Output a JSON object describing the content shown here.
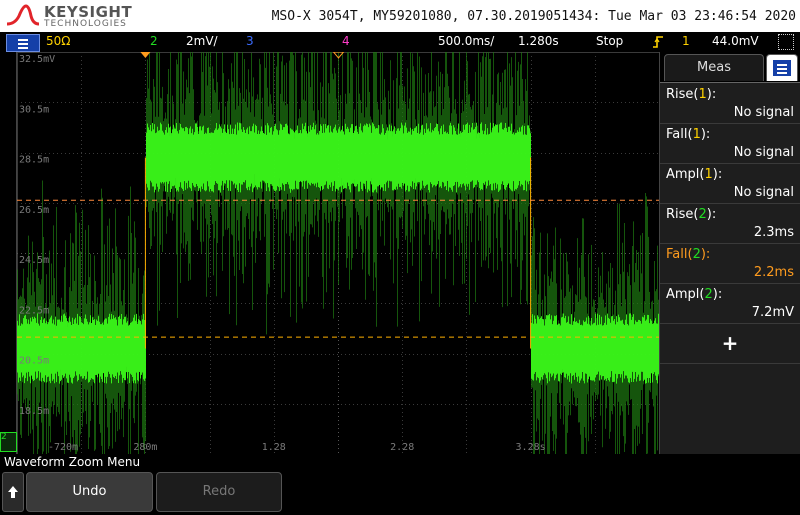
{
  "header": {
    "brand": "KEYSIGHT",
    "brand_sub": "TECHNOLOGIES",
    "instrument_info": "MSO-X 3054T, MY59201080, 07.30.2019051434: Tue Mar 03 23:46:54 2020"
  },
  "status": {
    "impedance": "50Ω",
    "ch2_num": "2",
    "ch2_scale": "2mV/",
    "ch3_num": "3",
    "ch4_num": "4",
    "timebase": "500.0ms/",
    "delay": "1.280s",
    "run_state": "Stop",
    "trigger_icon": "trigger-edge-icon",
    "trigger_source": "1",
    "trigger_level": "44.0mV"
  },
  "axes": {
    "y_labels": [
      "32.5mV",
      "30.5m",
      "28.5m",
      "26.5m",
      "24.5m",
      "22.5m",
      "20.5m",
      "18.5m"
    ],
    "x_labels": [
      "-720m",
      "280m",
      "1.28",
      "2.28",
      "3.28s"
    ]
  },
  "channel_marker": "2",
  "meas_panel": {
    "tab_label": "Meas",
    "rows": [
      {
        "name": "Rise",
        "channel": "1",
        "value": "No signal"
      },
      {
        "name": "Fall",
        "channel": "1",
        "value": "No signal"
      },
      {
        "name": "Ampl",
        "channel": "1",
        "value": "No signal"
      },
      {
        "name": "Rise",
        "channel": "2",
        "value": "2.3ms"
      },
      {
        "name": "Fall",
        "channel": "2",
        "value": "2.2ms"
      },
      {
        "name": "Ampl",
        "channel": "2",
        "value": "7.2mV"
      }
    ],
    "add_label": "+"
  },
  "softkeys": {
    "menu_title": "Waveform Zoom Menu",
    "undo": "Undo",
    "redo": "Redo"
  },
  "colors": {
    "ch1": "#ffd200",
    "ch2": "#22dd22",
    "ch3": "#3b6cff",
    "ch4": "#ff3cc8",
    "highlight": "#ff9c1e",
    "cursor": "#ff8a3c"
  },
  "chart_data": {
    "type": "line",
    "series": [
      {
        "name": "2",
        "x": [
          -0.72,
          0.28,
          0.28,
          3.28,
          3.28,
          4.28
        ],
        "y": [
          20.7,
          20.7,
          28.3,
          28.3,
          20.7,
          20.7
        ]
      }
    ],
    "ylim": [
      16.5,
      32.5
    ],
    "xlim": [
      -0.72,
      4.28
    ],
    "grid": true
  }
}
